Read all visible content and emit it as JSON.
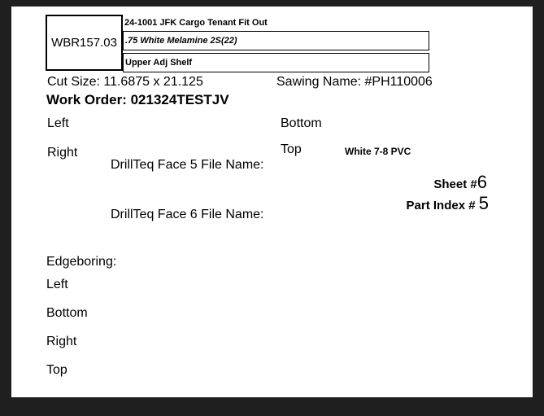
{
  "id_code": "WBR157.03",
  "header": {
    "project": "24-1001 JFK Cargo Tenant Fit Out",
    "material": ".75 White Melamine 2S(22)",
    "part_name": "Upper Adj Shelf"
  },
  "cut_size": {
    "label": "Cut Size:",
    "value": "11.6875 x 21.125"
  },
  "sawing_name": "Sawing Name: #PH110006",
  "work_order": "Work Order: 021324TESTJV",
  "edges": {
    "left": "Left",
    "right": "Right",
    "bottom": "Bottom",
    "top": "Top",
    "top_value": "White 7-8 PVC"
  },
  "drillteq": {
    "face5": "DrillTeq Face 5 File Name:",
    "face6": "DrillTeq Face 6 File Name:"
  },
  "sheet": {
    "label": "Sheet #",
    "value": "6"
  },
  "part_index": {
    "label": "Part Index #",
    "value": "5"
  },
  "edgeboring": {
    "title": "Edgeboring:",
    "left": "Left",
    "bottom": "Bottom",
    "right": "Right",
    "top": "Top"
  }
}
